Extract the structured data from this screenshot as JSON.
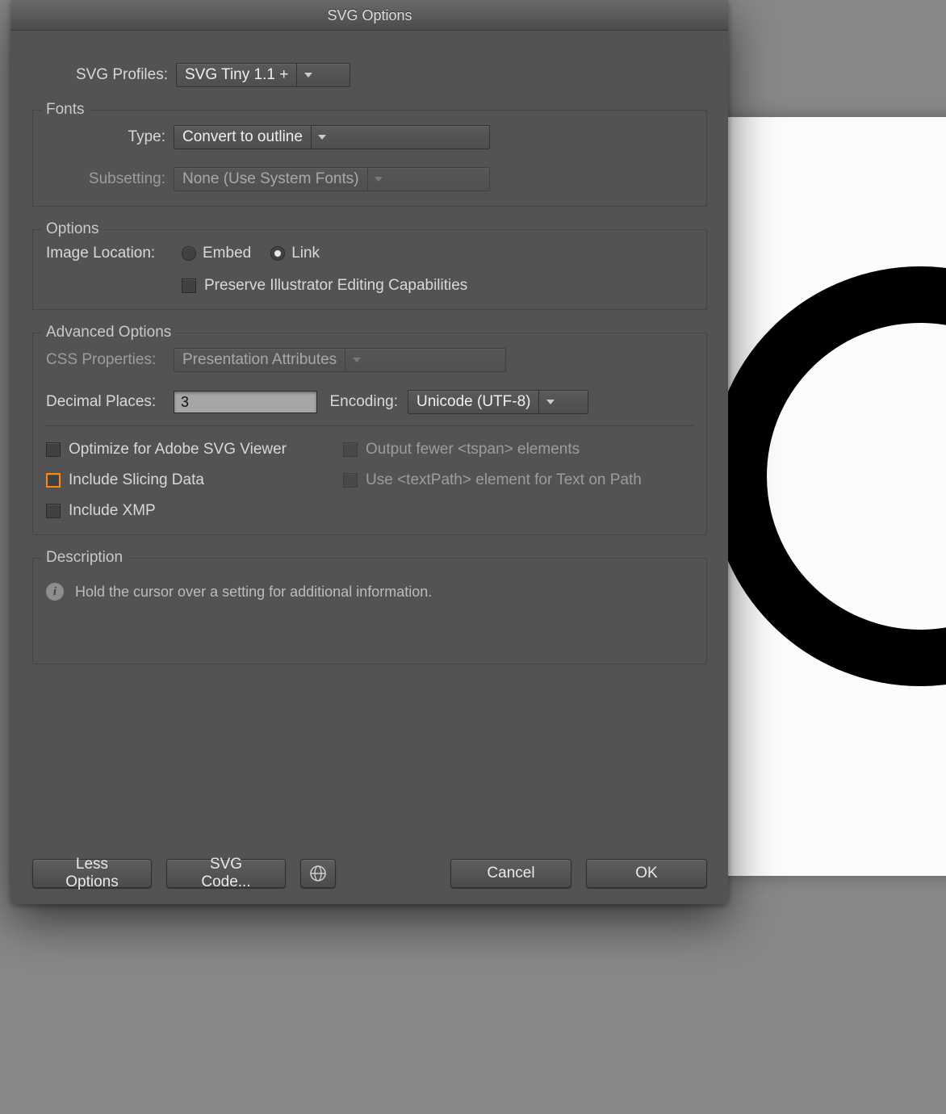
{
  "window": {
    "title": "SVG Options"
  },
  "profile": {
    "label": "SVG Profiles:",
    "value": "SVG Tiny 1.1 +"
  },
  "fonts": {
    "legend": "Fonts",
    "type_label": "Type:",
    "type_value": "Convert to outline",
    "subsetting_label": "Subsetting:",
    "subsetting_value": "None (Use System Fonts)"
  },
  "options": {
    "legend": "Options",
    "image_location_label": "Image Location:",
    "radio_embed": "Embed",
    "radio_link": "Link",
    "preserve_label": "Preserve Illustrator Editing Capabilities"
  },
  "advanced": {
    "legend": "Advanced Options",
    "css_label": "CSS Properties:",
    "css_value": "Presentation Attributes",
    "decimal_label": "Decimal Places:",
    "decimal_value": "3",
    "encoding_label": "Encoding:",
    "encoding_value": "Unicode (UTF-8)",
    "optimize_label": "Optimize for Adobe SVG Viewer",
    "tspan_label": "Output fewer <tspan> elements",
    "slicing_label": "Include Slicing Data",
    "textpath_label": "Use <textPath> element for Text on Path",
    "xmp_label": "Include XMP"
  },
  "description": {
    "legend": "Description",
    "text": "Hold the cursor over a setting for additional information."
  },
  "footer": {
    "less_options": "Less Options",
    "svg_code": "SVG Code...",
    "cancel": "Cancel",
    "ok": "OK"
  }
}
